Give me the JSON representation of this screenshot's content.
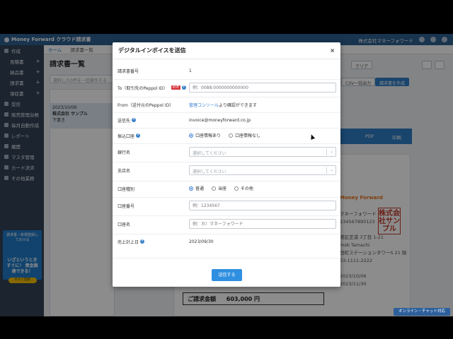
{
  "app": {
    "brand": "Money Forward クラウド請求書",
    "company": "株式会社マネーフォワード"
  },
  "sidebar": {
    "items": [
      {
        "label": "作成",
        "icon": "pencil-icon",
        "sub": false
      },
      {
        "label": "見積書",
        "sub": true,
        "plus": "+"
      },
      {
        "label": "納品書",
        "sub": true,
        "plus": "+"
      },
      {
        "label": "請求書",
        "sub": true,
        "plus": "+"
      },
      {
        "label": "領収書",
        "sub": true,
        "plus": "+"
      },
      {
        "label": "受信",
        "icon": "inbox-icon",
        "sub": false
      },
      {
        "label": "販売管理台帳",
        "icon": "ledger-icon",
        "sub": false
      },
      {
        "label": "毎月自動作成",
        "icon": "repeat-icon",
        "sub": false
      },
      {
        "label": "レポート",
        "icon": "report-icon",
        "sub": false
      },
      {
        "label": "履歴",
        "icon": "history-icon",
        "sub": false
      },
      {
        "label": "マスタ管理",
        "icon": "master-icon",
        "sub": false
      },
      {
        "label": "カード決済",
        "icon": "card-icon",
        "sub": false
      },
      {
        "label": "その他業務",
        "icon": "more-icon",
        "sub": false
      }
    ],
    "banner": {
      "top": "請求書・新規登録しておけば",
      "big": "いざというとき すぐに！ 資金調達できる！",
      "cta": "今すぐ登録"
    }
  },
  "background": {
    "breadcrumb": [
      "ホーム",
      "請求書一覧"
    ],
    "title": "請求書一覧",
    "search_placeholder": "選択した0件を一括操作する",
    "row_meta": "2023/10/06",
    "row_company": "株式会社 サンプル",
    "row_status": "下書き",
    "buttons": {
      "clear": "クリア",
      "csv": "CSV一括出力",
      "create": "請求書を作成"
    },
    "pdf": "PDF",
    "print": "印刷",
    "brand": "Money Forward",
    "addr": "マネーフォワード\n234567890123\n\n港区芝浦 3丁目 1-21\nmsb Tamachi\n田町ステーションタワーS 21 階\n03-1111-2222\n\n2023/10/06\n2023/11/30",
    "stamp": "株式会社サンプル",
    "total_label": "ご請求金額",
    "total_value": "603,000 円"
  },
  "modal": {
    "title": "デジタルインボイスを送信",
    "close": "×",
    "fields": {
      "invoice_no_label": "請求書番号",
      "invoice_no_value": "1",
      "to_label": "To（取引先のPeppol ID）",
      "to_required": "必須",
      "to_placeholder": "例：0088:0000000000000",
      "from_label": "From（送付元のPeppol ID）",
      "from_value_link": "管理コンソール",
      "from_value_rest": "より確認ができます",
      "email_label": "送信先",
      "email_value": "invoice@moneyforward.co.jp",
      "bank_label": "振込口座",
      "bank_opt1": "口座情報あり",
      "bank_opt2": "口座情報なし",
      "bankname_label": "銀行名",
      "bankname_placeholder": "選択してください",
      "branch_label": "支店名",
      "branch_placeholder": "選択してください",
      "type_label": "口座種別",
      "type_opt1": "普通",
      "type_opt2": "当座",
      "type_opt3": "その他",
      "accno_label": "口座番号",
      "accno_placeholder": "例：1234567",
      "accname_label": "口座名",
      "accname_placeholder": "例：カ）マネーフォワード",
      "date_label": "売上計上日",
      "date_value": "2023/09/30"
    },
    "send_label": "送信する"
  },
  "chat": {
    "label": "オンライン・チャット対応"
  },
  "colors": {
    "topbar": "#2d5f8f",
    "sidebar": "#324256",
    "primary": "#2f8fe0",
    "required": "#d9363e"
  }
}
